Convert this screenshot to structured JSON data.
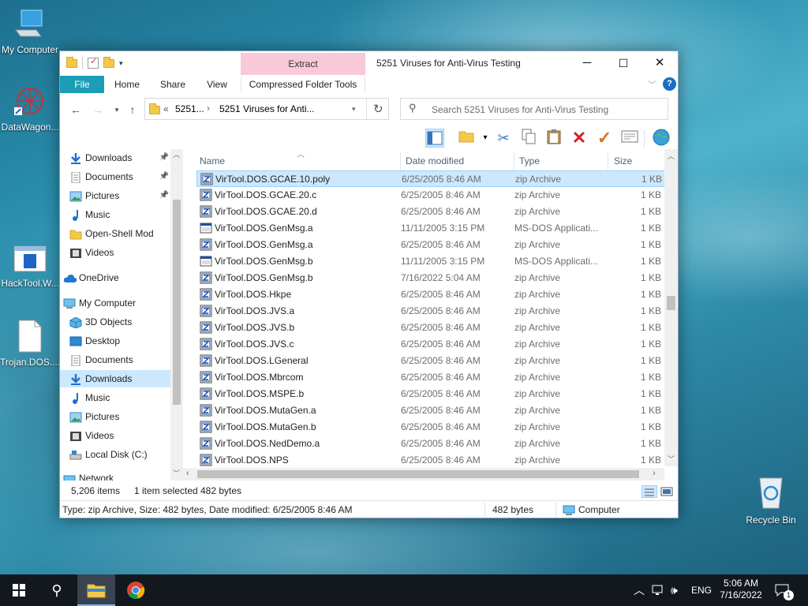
{
  "desktop": {
    "icons": [
      {
        "label": "My Computer"
      },
      {
        "label": "DataWagon..."
      },
      {
        "label": "HackTool.W..."
      },
      {
        "label": "Trojan.DOS...."
      },
      {
        "label": "Recycle Bin"
      }
    ]
  },
  "window": {
    "title": "5251 Viruses for Anti-Virus Testing",
    "context_tab": "Extract",
    "controls": {
      "minimize": "─",
      "maximize": "☐",
      "close": "✕"
    },
    "ribbon_tabs": [
      "File",
      "Home",
      "Share",
      "View",
      "Compressed Folder Tools"
    ],
    "address": {
      "chevron": "«",
      "crumbs": [
        "5251...",
        "5251 Viruses for Anti..."
      ]
    },
    "search_placeholder": "Search 5251 Viruses for Anti-Virus Testing",
    "colors": {
      "file_tab": "#1a9db5",
      "extract_tab": "#f9c9d9",
      "selection": "#cce8ff"
    }
  },
  "nav": {
    "items": [
      {
        "label": "Downloads",
        "icon": "download-arrow-icon",
        "pinned": true
      },
      {
        "label": "Documents",
        "icon": "documents-icon",
        "pinned": true
      },
      {
        "label": "Pictures",
        "icon": "pictures-icon",
        "pinned": true
      },
      {
        "label": "Music",
        "icon": "music-icon",
        "pinned": false
      },
      {
        "label": "Open-Shell Mod",
        "icon": "folder-icon",
        "pinned": false
      },
      {
        "label": "Videos",
        "icon": "videos-icon",
        "pinned": false
      },
      {
        "label": "OneDrive",
        "icon": "cloud-icon",
        "pinned": false
      },
      {
        "label": "My Computer",
        "icon": "computer-icon",
        "pinned": false
      },
      {
        "label": "3D Objects",
        "icon": "cube-icon",
        "pinned": false
      },
      {
        "label": "Desktop",
        "icon": "desktop-icon",
        "pinned": false
      },
      {
        "label": "Documents",
        "icon": "documents-icon",
        "pinned": false
      },
      {
        "label": "Downloads",
        "icon": "download-arrow-icon",
        "pinned": false,
        "selected": true
      },
      {
        "label": "Music",
        "icon": "music-icon",
        "pinned": false
      },
      {
        "label": "Pictures",
        "icon": "pictures-icon",
        "pinned": false
      },
      {
        "label": "Videos",
        "icon": "videos-icon",
        "pinned": false
      },
      {
        "label": "Local Disk (C:)",
        "icon": "disk-icon",
        "pinned": false
      },
      {
        "label": "Network",
        "icon": "network-icon",
        "pinned": false
      }
    ]
  },
  "list": {
    "columns": [
      "Name",
      "Date modified",
      "Type",
      "Size"
    ],
    "rows": [
      {
        "name": "VirTool.DOS.GCAE.10.poly",
        "date": "6/25/2005 8:46 AM",
        "type": "zip Archive",
        "size": "1 KB",
        "selected": true,
        "kind": "zip"
      },
      {
        "name": "VirTool.DOS.GCAE.20.c",
        "date": "6/25/2005 8:46 AM",
        "type": "zip Archive",
        "size": "1 KB",
        "kind": "zip"
      },
      {
        "name": "VirTool.DOS.GCAE.20.d",
        "date": "6/25/2005 8:46 AM",
        "type": "zip Archive",
        "size": "1 KB",
        "kind": "zip"
      },
      {
        "name": "VirTool.DOS.GenMsg.a",
        "date": "11/11/2005 3:15 PM",
        "type": "MS-DOS Applicati...",
        "size": "1 KB",
        "kind": "exe"
      },
      {
        "name": "VirTool.DOS.GenMsg.a",
        "date": "6/25/2005 8:46 AM",
        "type": "zip Archive",
        "size": "1 KB",
        "kind": "zip"
      },
      {
        "name": "VirTool.DOS.GenMsg.b",
        "date": "11/11/2005 3:15 PM",
        "type": "MS-DOS Applicati...",
        "size": "1 KB",
        "kind": "exe"
      },
      {
        "name": "VirTool.DOS.GenMsg.b",
        "date": "7/16/2022 5:04 AM",
        "type": "zip Archive",
        "size": "1 KB",
        "kind": "zip"
      },
      {
        "name": "VirTool.DOS.Hkpe",
        "date": "6/25/2005 8:46 AM",
        "type": "zip Archive",
        "size": "1 KB",
        "kind": "zip"
      },
      {
        "name": "VirTool.DOS.JVS.a",
        "date": "6/25/2005 8:46 AM",
        "type": "zip Archive",
        "size": "1 KB",
        "kind": "zip"
      },
      {
        "name": "VirTool.DOS.JVS.b",
        "date": "6/25/2005 8:46 AM",
        "type": "zip Archive",
        "size": "1 KB",
        "kind": "zip"
      },
      {
        "name": "VirTool.DOS.JVS.c",
        "date": "6/25/2005 8:46 AM",
        "type": "zip Archive",
        "size": "1 KB",
        "kind": "zip"
      },
      {
        "name": "VirTool.DOS.LGeneral",
        "date": "6/25/2005 8:46 AM",
        "type": "zip Archive",
        "size": "1 KB",
        "kind": "zip"
      },
      {
        "name": "VirTool.DOS.Mbrcom",
        "date": "6/25/2005 8:46 AM",
        "type": "zip Archive",
        "size": "1 KB",
        "kind": "zip"
      },
      {
        "name": "VirTool.DOS.MSPE.b",
        "date": "6/25/2005 8:46 AM",
        "type": "zip Archive",
        "size": "1 KB",
        "kind": "zip"
      },
      {
        "name": "VirTool.DOS.MutaGen.a",
        "date": "6/25/2005 8:46 AM",
        "type": "zip Archive",
        "size": "1 KB",
        "kind": "zip"
      },
      {
        "name": "VirTool.DOS.MutaGen.b",
        "date": "6/25/2005 8:46 AM",
        "type": "zip Archive",
        "size": "1 KB",
        "kind": "zip"
      },
      {
        "name": "VirTool.DOS.NedDemo.a",
        "date": "6/25/2005 8:46 AM",
        "type": "zip Archive",
        "size": "1 KB",
        "kind": "zip"
      },
      {
        "name": "VirTool.DOS.NPS",
        "date": "6/25/2005 8:46 AM",
        "type": "zip Archive",
        "size": "1 KB",
        "kind": "zip"
      }
    ]
  },
  "status": {
    "item_count": "5,206 items",
    "selected": "1 item selected",
    "selected_size": "482 bytes",
    "details": "Type: zip Archive, Size: 482 bytes, Date modified: 6/25/2005 8:46 AM",
    "size_right": "482 bytes",
    "location": "Computer"
  },
  "taskbar": {
    "lang": "ENG",
    "time": "5:06 AM",
    "date": "7/16/2022",
    "notif_count": "1"
  }
}
